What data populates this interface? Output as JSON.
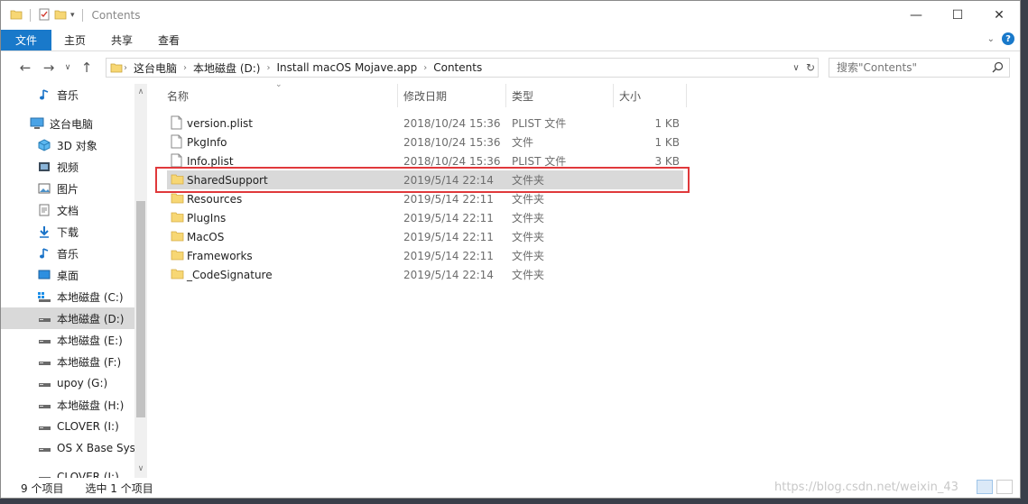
{
  "window": {
    "title": "Contents"
  },
  "ribbon": {
    "tabs": [
      "文件",
      "主页",
      "共享",
      "查看"
    ]
  },
  "address": {
    "crumbs": [
      "这台电脑",
      "本地磁盘 (D:)",
      "Install macOS Mojave.app",
      "Contents"
    ]
  },
  "search": {
    "placeholder": "搜索\"Contents\""
  },
  "sidebar": {
    "items": [
      {
        "label": "音乐",
        "icon": "music-icon",
        "indent": 1
      },
      {
        "label": "这台电脑",
        "icon": "computer-icon",
        "indent": 0
      },
      {
        "label": "3D 对象",
        "icon": "cube-icon",
        "indent": 1
      },
      {
        "label": "视频",
        "icon": "video-icon",
        "indent": 1
      },
      {
        "label": "图片",
        "icon": "picture-icon",
        "indent": 1
      },
      {
        "label": "文档",
        "icon": "document-icon",
        "indent": 1
      },
      {
        "label": "下载",
        "icon": "download-icon",
        "indent": 1
      },
      {
        "label": "音乐",
        "icon": "music-icon",
        "indent": 1
      },
      {
        "label": "桌面",
        "icon": "desktop-icon",
        "indent": 1
      },
      {
        "label": "本地磁盘 (C:)",
        "icon": "windows-drive-icon",
        "indent": 1
      },
      {
        "label": "本地磁盘 (D:)",
        "icon": "drive-icon",
        "indent": 1,
        "selected": true
      },
      {
        "label": "本地磁盘 (E:)",
        "icon": "drive-icon",
        "indent": 1
      },
      {
        "label": "本地磁盘 (F:)",
        "icon": "drive-icon",
        "indent": 1
      },
      {
        "label": "upoy (G:)",
        "icon": "drive-icon",
        "indent": 1
      },
      {
        "label": "本地磁盘 (H:)",
        "icon": "drive-icon",
        "indent": 1
      },
      {
        "label": "CLOVER (I:)",
        "icon": "drive-icon",
        "indent": 1
      },
      {
        "label": "OS X Base Syste",
        "icon": "drive-icon",
        "indent": 1
      },
      {
        "label": "CLOVER (I:)",
        "icon": "drive-icon",
        "indent": 1
      }
    ]
  },
  "columns": {
    "name": "名称",
    "date": "修改日期",
    "type": "类型",
    "size": "大小"
  },
  "files": [
    {
      "name": "version.plist",
      "date": "2018/10/24 15:36",
      "type": "PLIST 文件",
      "size": "1 KB",
      "kind": "file"
    },
    {
      "name": "PkgInfo",
      "date": "2018/10/24 15:36",
      "type": "文件",
      "size": "1 KB",
      "kind": "file"
    },
    {
      "name": "Info.plist",
      "date": "2018/10/24 15:36",
      "type": "PLIST 文件",
      "size": "3 KB",
      "kind": "file"
    },
    {
      "name": "SharedSupport",
      "date": "2019/5/14 22:14",
      "type": "文件夹",
      "size": "",
      "kind": "folder",
      "selected": true
    },
    {
      "name": "Resources",
      "date": "2019/5/14 22:11",
      "type": "文件夹",
      "size": "",
      "kind": "folder"
    },
    {
      "name": "PlugIns",
      "date": "2019/5/14 22:11",
      "type": "文件夹",
      "size": "",
      "kind": "folder"
    },
    {
      "name": "MacOS",
      "date": "2019/5/14 22:11",
      "type": "文件夹",
      "size": "",
      "kind": "folder"
    },
    {
      "name": "Frameworks",
      "date": "2019/5/14 22:11",
      "type": "文件夹",
      "size": "",
      "kind": "folder"
    },
    {
      "name": "_CodeSignature",
      "date": "2019/5/14 22:14",
      "type": "文件夹",
      "size": "",
      "kind": "folder"
    }
  ],
  "status": {
    "count": "9 个项目",
    "selection": "选中 1 个项目"
  },
  "watermark": "https://blog.csdn.net/weixin_43",
  "colors": {
    "accent": "#1979ca",
    "highlight": "#e0393b",
    "folder": "#f7d774",
    "selection": "#d9d9d9"
  }
}
